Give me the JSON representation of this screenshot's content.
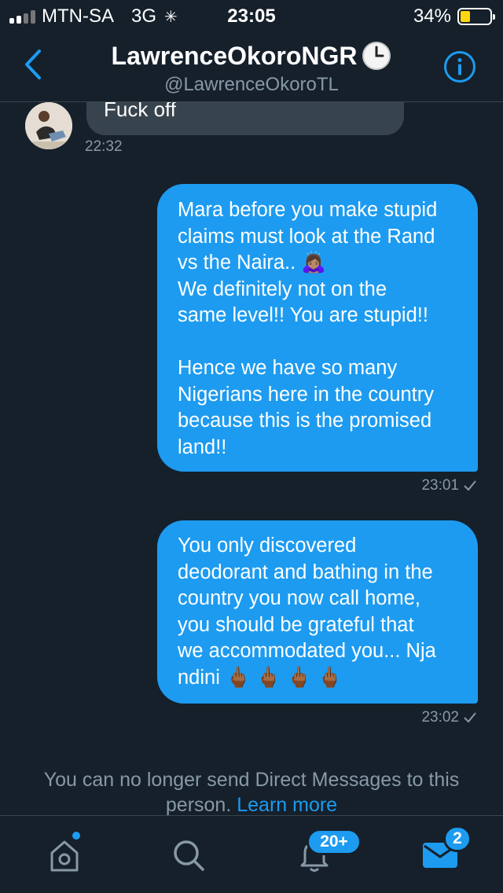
{
  "status_bar": {
    "carrier": "MTN-SA",
    "network": "3G",
    "time": "23:05",
    "battery_percent": "34%",
    "battery_level": 0.34
  },
  "header": {
    "title": "LawrenceOkoroNGR",
    "title_emoji": "clock-icon",
    "handle": "@LawrenceOkoroTL",
    "back_icon": "chevron-left-icon",
    "info_icon": "info-icon"
  },
  "messages": [
    {
      "direction": "received",
      "lines": [
        "Fuck off"
      ],
      "time": "22:32"
    },
    {
      "direction": "sent",
      "lines": [
        "Mara before you make stupid",
        "claims must look at the Rand",
        "vs the Naira.. 🙇🏽‍♀️",
        "We definitely not on the",
        "same level!! You are stupid!!",
        "",
        "Hence we have so many",
        "Nigerians here in the country",
        "because this is the promised",
        "land!!"
      ],
      "time": "23:01",
      "status_icon": "checkmark-icon"
    },
    {
      "direction": "sent",
      "lines": [
        "You only discovered",
        "deodorant and bathing in the",
        "country you now call home,",
        "you should be grateful that",
        "we accommodated you... Nja",
        "ndini 🖕🏾 🖕🏾 🖕🏾 🖕🏾"
      ],
      "time": "23:02",
      "status_icon": "checkmark-icon"
    }
  ],
  "notice": {
    "text": "You can no longer send Direct Messages to this person.",
    "link": "Learn more"
  },
  "tab_bar": {
    "home_icon": "home-icon",
    "search_icon": "search-icon",
    "notifications_icon": "bell-icon",
    "notifications_badge": "20+",
    "messages_icon": "mail-icon",
    "messages_badge": "2"
  },
  "colors": {
    "background": "#15202b",
    "accent": "#1d9bf0",
    "received_bubble": "#38444d",
    "secondary_text": "#8899a6",
    "battery": "#ffd60a"
  }
}
